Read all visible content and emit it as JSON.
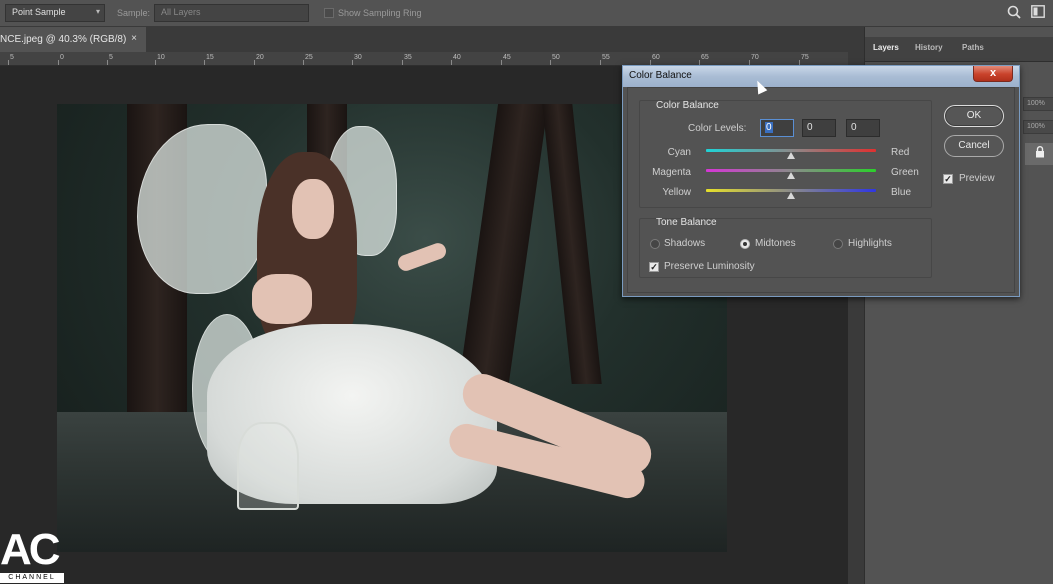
{
  "options_bar": {
    "sample_size": "Point Sample",
    "sample_label": "Sample:",
    "sample_value": "All Layers",
    "show_ring_label": "Show Sampling Ring",
    "search_icon": "search-icon",
    "workspace_icon": "workspace-icon"
  },
  "document": {
    "tab_title": "NCE.jpeg @ 40.3% (RGB/8)",
    "close_label": "×"
  },
  "ruler": {
    "ticks": [
      "5",
      "0",
      "5",
      "10",
      "15",
      "20",
      "25",
      "30",
      "35",
      "40",
      "45",
      "50",
      "55",
      "60",
      "65",
      "70",
      "75"
    ]
  },
  "panels": {
    "tabs": [
      "Layers",
      "History",
      "Paths"
    ],
    "opacity_chip": "100%",
    "fill_chip": "100%"
  },
  "watermark": {
    "logo": "AC",
    "channel": "CHANNEL"
  },
  "dialog": {
    "title": "Color Balance",
    "close_label": "x",
    "color_balance_group": "Color Balance",
    "color_levels_label": "Color Levels:",
    "levels": [
      "0",
      "0",
      "0"
    ],
    "sliders": [
      {
        "left": "Cyan",
        "right": "Red",
        "value": 0,
        "colors": [
          "#1fd3d6",
          "#e03030"
        ]
      },
      {
        "left": "Magenta",
        "right": "Green",
        "value": 0,
        "colors": [
          "#d636d6",
          "#2bd02b"
        ]
      },
      {
        "left": "Yellow",
        "right": "Blue",
        "value": 0,
        "colors": [
          "#e6e02a",
          "#2f36e4"
        ]
      }
    ],
    "tone_balance_group": "Tone Balance",
    "tones": [
      "Shadows",
      "Midtones",
      "Highlights"
    ],
    "selected_tone": "Midtones",
    "preserve_luminosity": "Preserve Luminosity",
    "preserve_checked": true,
    "ok_label": "OK",
    "cancel_label": "Cancel",
    "preview_label": "Preview",
    "preview_checked": true
  }
}
